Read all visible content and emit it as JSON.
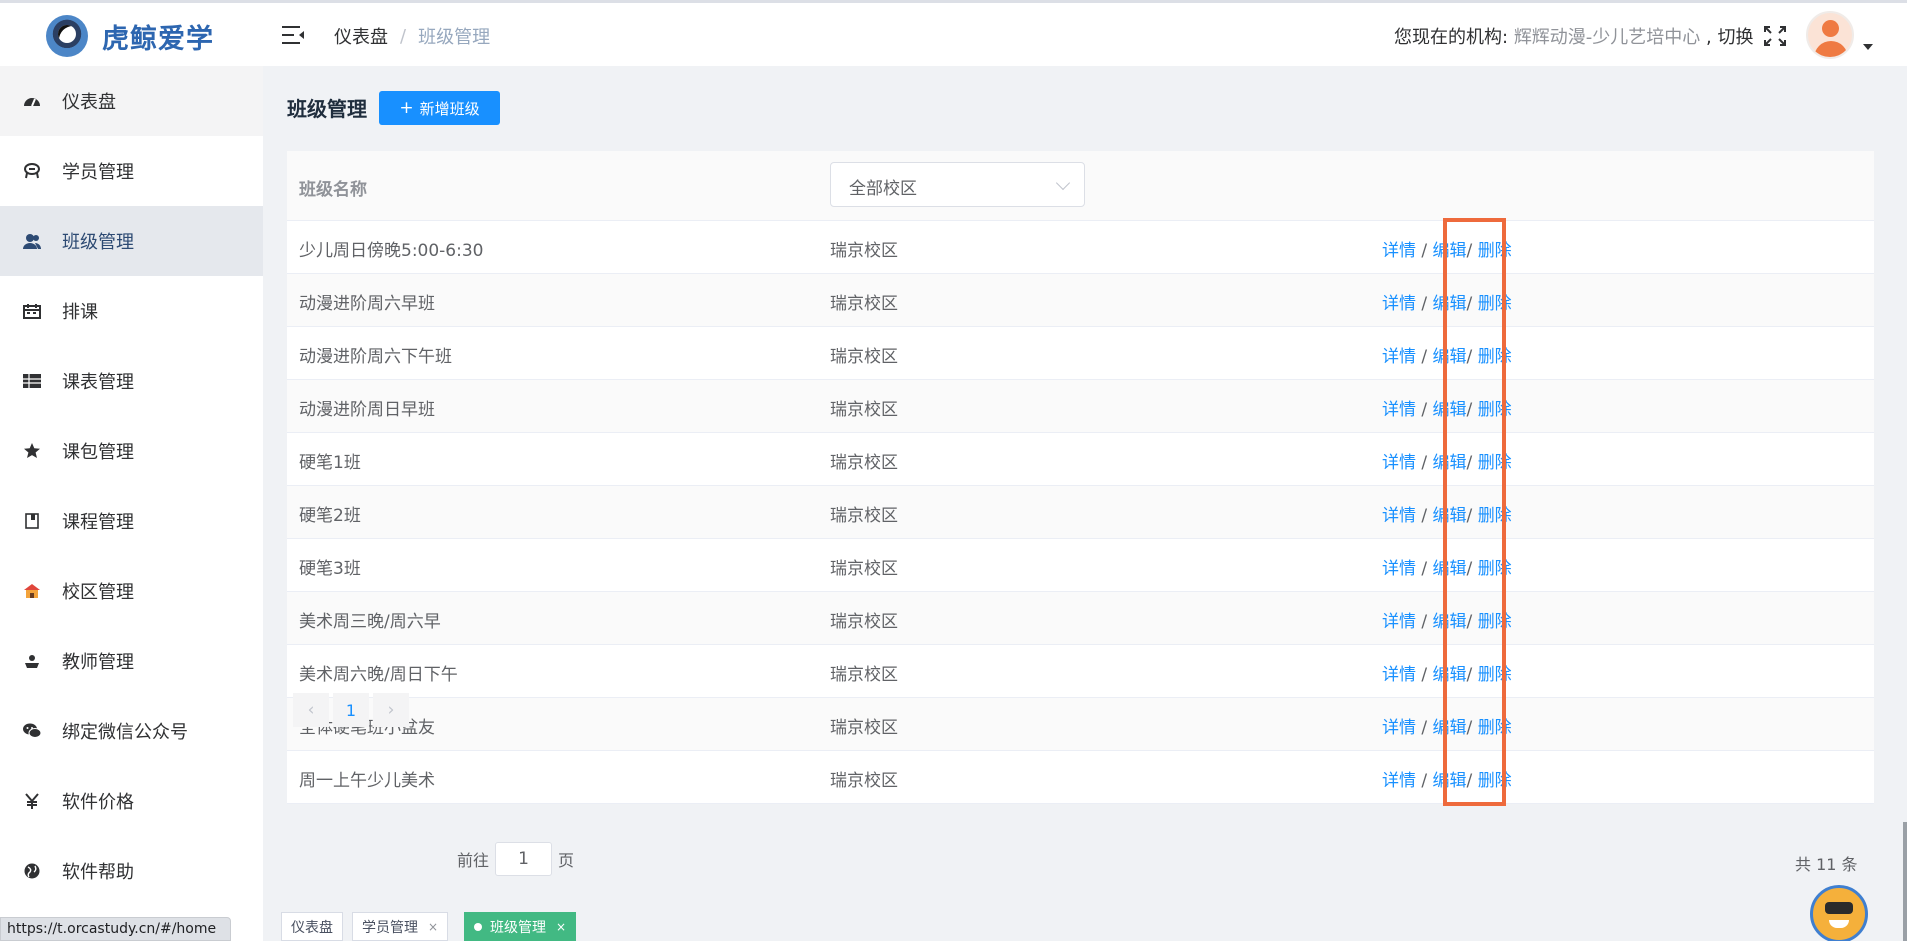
{
  "header": {
    "app_name": "虎鲸爱学",
    "breadcrumb": [
      "仪表盘",
      "班级管理"
    ],
    "breadcrumb_sep": "/",
    "org_label": "您现在的机构:",
    "org_name": "辉辉动漫-少儿艺培中心",
    "switch_label": ", 切换"
  },
  "sidebar": {
    "items": [
      {
        "label": "仪表盘",
        "icon": "dashboard-icon"
      },
      {
        "label": "学员管理",
        "icon": "student-icon"
      },
      {
        "label": "班级管理",
        "icon": "people-icon"
      },
      {
        "label": "排课",
        "icon": "calendar-icon"
      },
      {
        "label": "课表管理",
        "icon": "table-icon"
      },
      {
        "label": "课包管理",
        "icon": "star-icon"
      },
      {
        "label": "课程管理",
        "icon": "book-icon"
      },
      {
        "label": "校区管理",
        "icon": "school-icon"
      },
      {
        "label": "教师管理",
        "icon": "teacher-icon"
      },
      {
        "label": "绑定微信公众号",
        "icon": "wechat-icon"
      },
      {
        "label": "软件价格",
        "icon": "yen-icon"
      },
      {
        "label": "软件帮助",
        "icon": "globe-icon"
      }
    ],
    "active": "班级管理"
  },
  "page": {
    "title": "班级管理",
    "add_button": "新增班级",
    "add_icon": "+"
  },
  "table": {
    "header_name": "班级名称",
    "campus_filter": "全部校区",
    "rows": [
      {
        "name": "少儿周日傍晚5:00-6:30",
        "campus": "瑞京校区"
      },
      {
        "name": "动漫进阶周六早班",
        "campus": "瑞京校区"
      },
      {
        "name": "动漫进阶周六下午班",
        "campus": "瑞京校区"
      },
      {
        "name": "动漫进阶周日早班",
        "campus": "瑞京校区"
      },
      {
        "name": "硬笔1班",
        "campus": "瑞京校区"
      },
      {
        "name": "硬笔2班",
        "campus": "瑞京校区"
      },
      {
        "name": "硬笔3班",
        "campus": "瑞京校区"
      },
      {
        "name": "美术周三晚/周六早",
        "campus": "瑞京校区"
      },
      {
        "name": "美术周六晚/周日下午",
        "campus": "瑞京校区"
      },
      {
        "name": "全体硬笔班小盆友",
        "campus": "瑞京校区"
      },
      {
        "name": "周一上午少儿美术",
        "campus": "瑞京校区"
      }
    ],
    "actions": {
      "detail": "详情",
      "edit": "编辑",
      "delete": "删除",
      "sep": "/"
    }
  },
  "pagination": {
    "prev": "‹",
    "next": "›",
    "current_page": "1",
    "goto_prefix": "前往",
    "goto_value": "1",
    "goto_suffix": "页",
    "total": "共 11 条"
  },
  "tabs": [
    {
      "label": "仪表盘",
      "closable": false,
      "active": false
    },
    {
      "label": "学员管理",
      "closable": true,
      "active": false
    },
    {
      "label": "班级管理",
      "closable": true,
      "active": true
    }
  ],
  "tab_close": "×",
  "status_url": "https://t.orcastudy.cn/#/home",
  "colors": {
    "primary": "#1890ff",
    "tab_active": "#42b983",
    "highlight": "#ee6a3c"
  }
}
